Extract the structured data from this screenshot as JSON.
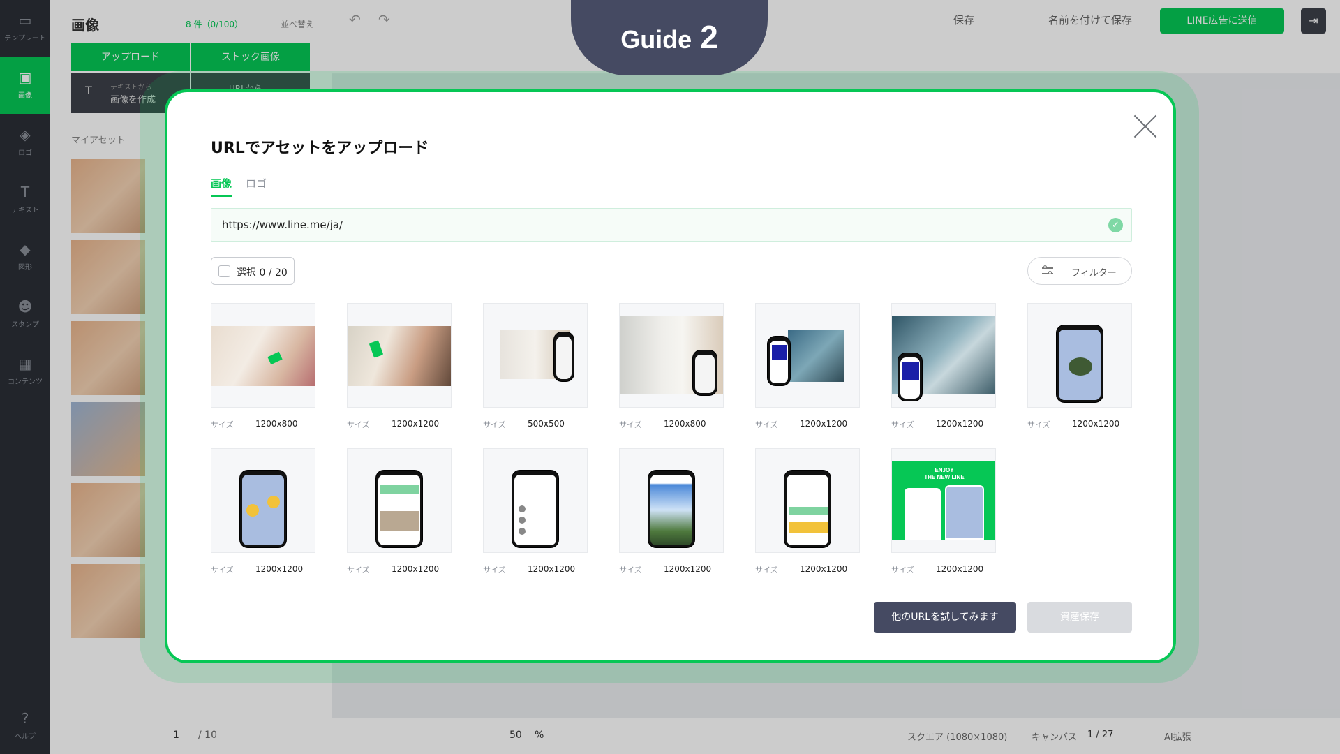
{
  "background": {
    "rail_items": [
      {
        "label": "テンプレート",
        "icon": "template-icon"
      },
      {
        "label": "画像",
        "icon": "image-icon"
      },
      {
        "label": "ロゴ",
        "icon": "logo-icon"
      },
      {
        "label": "テキスト",
        "icon": "text-icon"
      },
      {
        "label": "図形",
        "icon": "shape-icon"
      },
      {
        "label": "スタンプ",
        "icon": "sticker-icon"
      },
      {
        "label": "コンテンツ",
        "icon": "content-icon"
      }
    ],
    "help_label": "ヘルプ",
    "panel_title": "画像",
    "panel_count": "8 件（0/100）",
    "panel_sort": "並べ替え",
    "panel_tabs": [
      "アップロード",
      "ストック画像"
    ],
    "create_label_small": "テキストから",
    "create_label": "画像を作成",
    "url_label": "URLから",
    "my_assets": "マイアセット",
    "topbar": {
      "save": "保存",
      "save_as": "名前を付けて保存",
      "send": "LINE広告に送信"
    },
    "bottom": {
      "page": "1",
      "page_total": "/ 10",
      "zoom": "50",
      "zoom_unit": "%",
      "size": "スクエア (1080×1080)",
      "canvas_label": "キャンバス",
      "canvas_count": "1 / 27",
      "ai_label": "AI拡張"
    }
  },
  "guide": {
    "word": "Guide",
    "number": "2"
  },
  "modal": {
    "title": "URLでアセットをアップロード",
    "tabs": [
      "画像",
      "ロゴ"
    ],
    "url_value": "https://www.line.me/ja/",
    "select_label": "選択",
    "select_count": "0 / 20",
    "filter_label": "フィルター",
    "size_label": "サイズ",
    "images": [
      {
        "size": "1200x800"
      },
      {
        "size": "1200x1200"
      },
      {
        "size": "500x500"
      },
      {
        "size": "1200x800"
      },
      {
        "size": "1200x1200"
      },
      {
        "size": "1200x1200"
      },
      {
        "size": "1200x1200"
      },
      {
        "size": "1200x1200"
      },
      {
        "size": "1200x1200"
      },
      {
        "size": "1200x1200"
      },
      {
        "size": "1200x1200"
      },
      {
        "size": "1200x1200"
      },
      {
        "size": "1200x1200"
      }
    ],
    "banner_text": [
      "ENJOY",
      "THE NEW LINE"
    ],
    "try_other_url": "他のURLを試してみます",
    "save_assets": "資産保存"
  },
  "colors": {
    "accent": "#06c755",
    "dark": "#454a62"
  }
}
